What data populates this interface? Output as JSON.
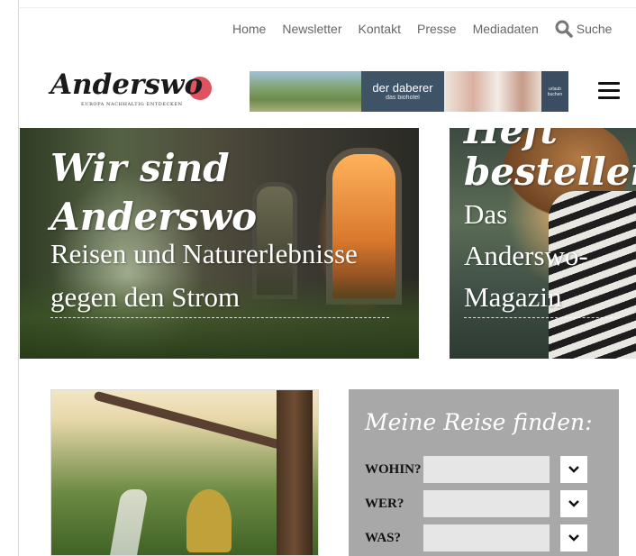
{
  "topnav": {
    "items": [
      "Home",
      "Newsletter",
      "Kontakt",
      "Presse",
      "Mediadaten"
    ],
    "search_label": "Suche"
  },
  "logo": {
    "wordmark": "Anderswo",
    "tagline": "EUROPA NACHHALTIG ENTDECKEN"
  },
  "banner": {
    "brand": "der daberer",
    "brand_sub": "das biohotel",
    "cta_top": "urlaub",
    "cta_bottom": "buchen"
  },
  "hero_left": {
    "script_line1": "Wir sind",
    "script_line2": "Anderswo",
    "sub_line1": "Reisen und Naturerlebnisse",
    "sub_line2": "gegen den Strom"
  },
  "hero_right": {
    "script_line1": "Heft",
    "script_line2": "bestellen",
    "sub_line1": "Das",
    "sub_line2": "Anderswo-",
    "sub_line3": "Magazin"
  },
  "finder": {
    "title": "Meine Reise finden:",
    "rows": [
      {
        "label": "WOHIN?",
        "value": ""
      },
      {
        "label": "WER?",
        "value": ""
      },
      {
        "label": "WAS?",
        "value": ""
      }
    ]
  },
  "colors": {
    "logo_dot": "#e05260",
    "finder_bg": "#a8a8a8",
    "field_bg": "#e6e6e6",
    "nav_text": "#666666"
  }
}
